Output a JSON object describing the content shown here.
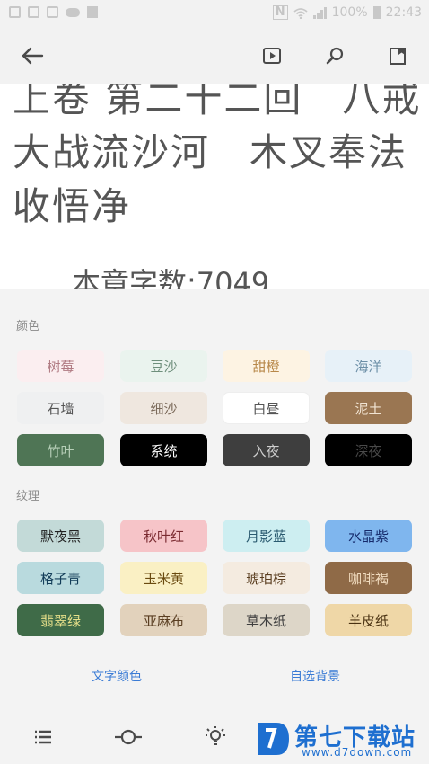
{
  "status_bar": {
    "battery": "100%",
    "time": "22:43"
  },
  "toolbar": {
    "back_icon": "arrow-left-icon",
    "play_icon": "play-box-icon",
    "search_icon": "search-icon",
    "bookmark_icon": "bookmark-icon"
  },
  "page": {
    "chapter_title": "上卷 第二十二回　八戒大战流沙河　木叉奉法收悟净",
    "word_count": "本章字数:7049"
  },
  "panel": {
    "color_section_label": "颜色",
    "texture_section_label": "纹理",
    "colors": [
      {
        "label": "树莓",
        "bg": "#fbeef0",
        "fg": "#b07a82"
      },
      {
        "label": "豆沙",
        "bg": "#eaf3ee",
        "fg": "#6f8f7c"
      },
      {
        "label": "甜橙",
        "bg": "#fdf3e3",
        "fg": "#b8884a"
      },
      {
        "label": "海洋",
        "bg": "#e7f1f8",
        "fg": "#6b8ea6"
      },
      {
        "label": "石墙",
        "bg": "#eff0f1",
        "fg": "#555555"
      },
      {
        "label": "细沙",
        "bg": "#efe7df",
        "fg": "#7b6a5a"
      },
      {
        "label": "白昼",
        "bg": "#ffffff",
        "fg": "#555555"
      },
      {
        "label": "泥土",
        "bg": "#9a7652",
        "fg": "#f1e4d3"
      },
      {
        "label": "竹叶",
        "bg": "#4f7555",
        "fg": "#b7cfb8"
      },
      {
        "label": "系统",
        "bg": "#000000",
        "fg": "#ffffff"
      },
      {
        "label": "入夜",
        "bg": "#3e3e3e",
        "fg": "#cfcfcf"
      },
      {
        "label": "深夜",
        "bg": "#000000",
        "fg": "#4a4a4a"
      }
    ],
    "textures": [
      {
        "label": "默夜黑",
        "bg": "#c3dad8",
        "fg": "#222222"
      },
      {
        "label": "秋叶红",
        "bg": "#f6c4c8",
        "fg": "#7a2a30"
      },
      {
        "label": "月影蓝",
        "bg": "#cdeef1",
        "fg": "#2a5a70"
      },
      {
        "label": "水晶紫",
        "bg": "#7fb6ee",
        "fg": "#152a6b"
      },
      {
        "label": "格子青",
        "bg": "#b9dade",
        "fg": "#123c58"
      },
      {
        "label": "玉米黄",
        "bg": "#faf0c4",
        "fg": "#6a4a10"
      },
      {
        "label": "琥珀棕",
        "bg": "#f4ebe0",
        "fg": "#5a3e20"
      },
      {
        "label": "咖啡褐",
        "bg": "#8f6a47",
        "fg": "#f1dcbf"
      },
      {
        "label": "翡翠绿",
        "bg": "#3f6b48",
        "fg": "#e7e08a"
      },
      {
        "label": "亚麻布",
        "bg": "#e2d2bc",
        "fg": "#5a3e22"
      },
      {
        "label": "草木纸",
        "bg": "#ddd6c8",
        "fg": "#3e3e3e"
      },
      {
        "label": "羊皮纸",
        "bg": "#efd7a7",
        "fg": "#4a3212"
      }
    ],
    "text_color_link": "文字颜色",
    "custom_bg_link": "自选背景"
  },
  "bottom_bar": {
    "icons": [
      "list-icon",
      "brightness-slider-icon",
      "lightbulb-icon"
    ]
  },
  "watermark": {
    "title": "第七下载站",
    "url": "www.d7down.com"
  },
  "accent_color": "#3a7bd5"
}
